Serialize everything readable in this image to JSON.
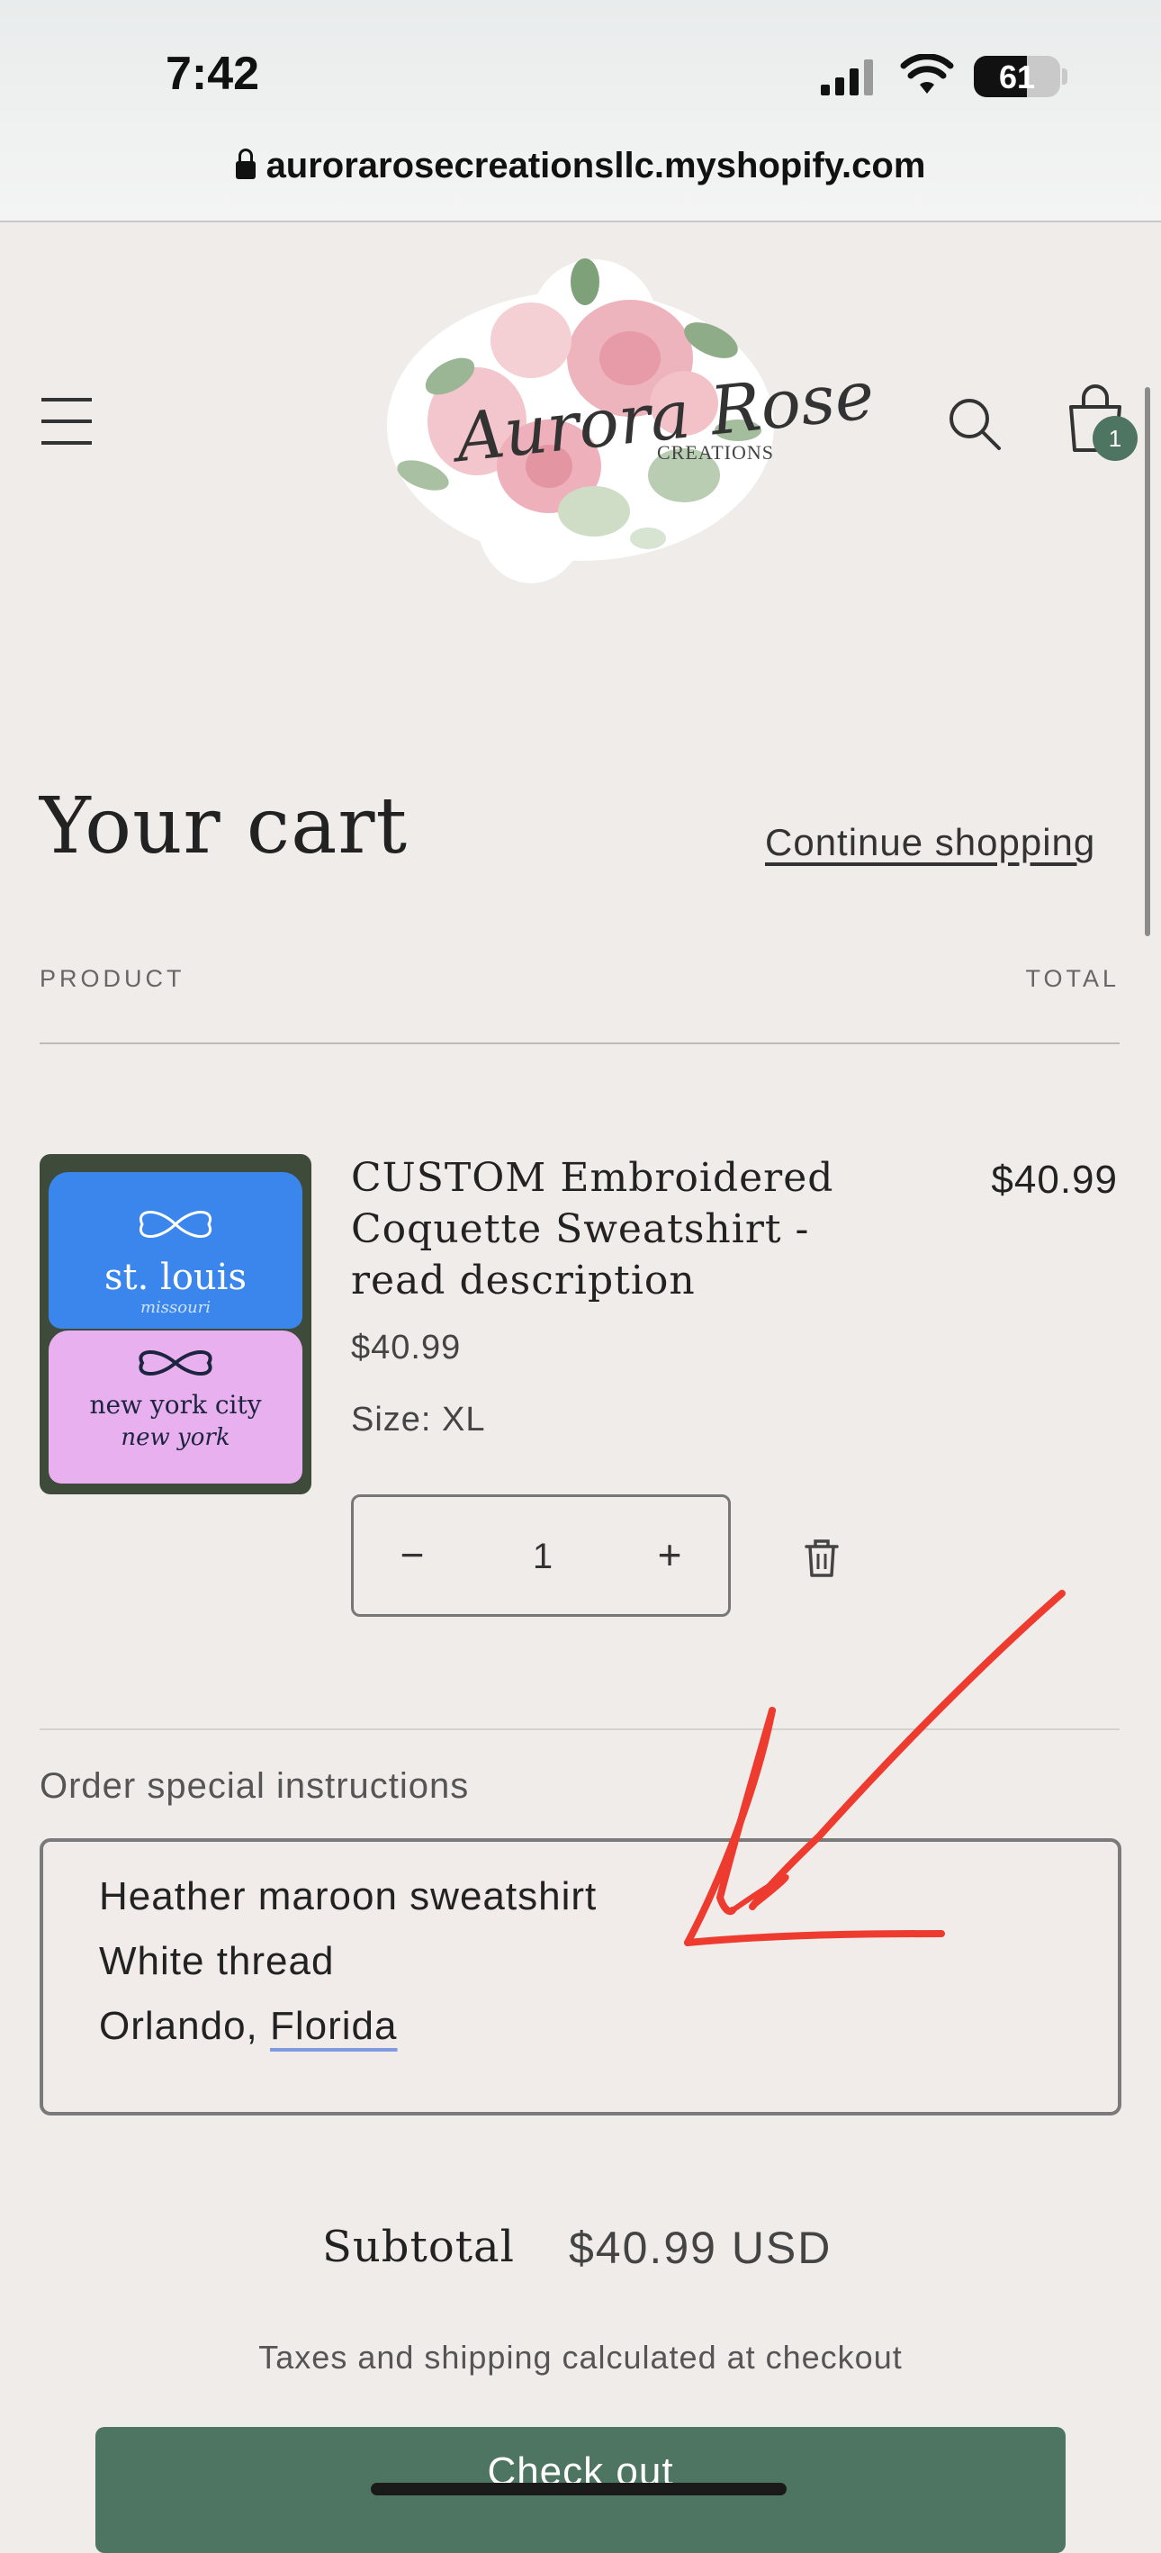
{
  "status_bar": {
    "time": "7:42",
    "battery": "61",
    "battery_level": 0.61
  },
  "browser": {
    "url": "aurorarosecreationsllc.myshopify.com"
  },
  "header": {
    "logo_text": "Aurora Rose",
    "logo_subtext": "CREATIONS",
    "cart_count": "1",
    "icons": {
      "menu": "hamburger-icon",
      "search": "search-icon",
      "cart": "bag-icon"
    }
  },
  "cart": {
    "title": "Your cart",
    "continue_label": "Continue shopping",
    "columns": {
      "product": "PRODUCT",
      "total": "TOTAL"
    },
    "items": [
      {
        "name": "CUSTOM Embroidered Coquette Sweatshirt - read description",
        "price": "$40.99",
        "variant": "Size: XL",
        "quantity": "1",
        "line_total": "$40.99",
        "image_text": {
          "top": "st. louis",
          "top_sub": "missouri",
          "bottom": "new york city",
          "bottom_sub": "new york"
        }
      }
    ],
    "instructions_label": "Order special instructions",
    "instructions_lines": [
      "Heather maroon sweatshirt",
      "White thread",
      "Orlando, "
    ],
    "instructions_last_word": "Florida",
    "subtotal_label": "Subtotal",
    "subtotal_value": "$40.99 USD",
    "tax_note": "Taxes and shipping calculated at checkout",
    "checkout_label": "Check out"
  },
  "colors": {
    "accent": "#4d7561",
    "background": "#f0ecea",
    "annotation": "#ee3b2f"
  }
}
